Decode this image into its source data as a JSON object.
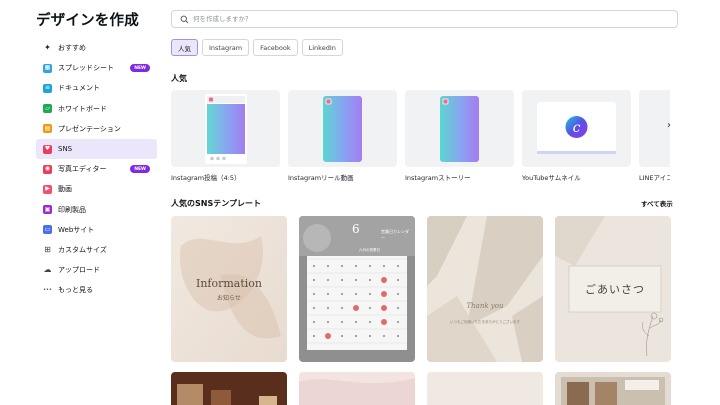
{
  "app_title": "デザインを作成",
  "sidebar": {
    "items": [
      {
        "label": "おすすめ",
        "icon": "sparkle-grid-icon",
        "color": "#1d232b"
      },
      {
        "label": "スプレッドシート",
        "icon": "spreadsheet-icon",
        "color": "#2ea5e0",
        "badge": "NEW"
      },
      {
        "label": "ドキュメント",
        "icon": "document-icon",
        "color": "#19a7d6"
      },
      {
        "label": "ホワイトボード",
        "icon": "whiteboard-icon",
        "color": "#1fa855"
      },
      {
        "label": "プレゼンテーション",
        "icon": "presentation-icon",
        "color": "#f29a0f"
      },
      {
        "label": "SNS",
        "icon": "heart-icon",
        "color": "#ef3b5a"
      },
      {
        "label": "写真エディター",
        "icon": "camera-icon",
        "color": "#ef3b5a",
        "badge": "NEW"
      },
      {
        "label": "動画",
        "icon": "video-icon",
        "color": "#f24e6f"
      },
      {
        "label": "印刷製品",
        "icon": "print-icon",
        "color": "#a028d0"
      },
      {
        "label": "Webサイト",
        "icon": "website-icon",
        "color": "#4b6ef0"
      },
      {
        "label": "カスタムサイズ",
        "icon": "custom-size-icon",
        "color": "#3f4650"
      },
      {
        "label": "アップロード",
        "icon": "cloud-upload-icon",
        "color": "#3f4650"
      },
      {
        "label": "もっと見る",
        "icon": "more-dots-icon",
        "color": "#3f4650"
      }
    ],
    "active_index": 5
  },
  "search": {
    "placeholder": "何を作成しますか？"
  },
  "chips": [
    "人気",
    "Instagram",
    "Facebook",
    "LinkedIn"
  ],
  "popular": {
    "title": "人気",
    "items": [
      {
        "label": "Instagram投稿（4:5）",
        "kind": "post"
      },
      {
        "label": "Instagramリール動画",
        "kind": "reel"
      },
      {
        "label": "Instagramストーリー",
        "kind": "story"
      },
      {
        "label": "YouTubeサムネイル",
        "kind": "youtube"
      },
      {
        "label": "LINEアイコン",
        "kind": "line"
      }
    ]
  },
  "templates": {
    "title": "人気のSNSテンプレート",
    "see_all": "すべて表示",
    "cards": [
      {
        "title": "Information",
        "subtitle": "お知らせ"
      },
      {
        "month": "6",
        "caption": "営業日カレンダー",
        "note": "六月の営業日"
      },
      {
        "script": "Thank you",
        "subtitle": "いつもご利用いただきありがとうございます"
      },
      {
        "title": "ごあいさつ"
      }
    ]
  },
  "colors": {
    "accent": "#7d2ae8",
    "active_bg": "#ece6fb"
  }
}
